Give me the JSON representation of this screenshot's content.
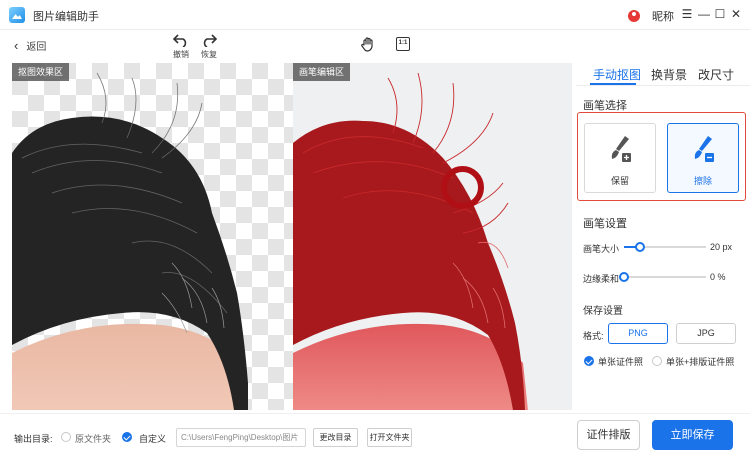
{
  "app": {
    "title": "图片编辑助手",
    "user_name": "昵称"
  },
  "window_controls": {
    "menu": "☰",
    "minimize": "—",
    "maximize": "☐",
    "close": "✕"
  },
  "toolbar": {
    "back": "返回",
    "undo": "撤销",
    "redo": "恢复",
    "hand_icon": "hand-icon",
    "ratio_icon_text": "1:1"
  },
  "panels": {
    "left_label": "抠图效果区",
    "right_label": "画笔编辑区"
  },
  "tabs": [
    {
      "label": "手动抠图",
      "active": true
    },
    {
      "label": "换背景",
      "active": false
    },
    {
      "label": "改尺寸",
      "active": false
    }
  ],
  "brush_select": {
    "title": "画笔选择",
    "options": [
      {
        "label": "保留",
        "icon": "brush-keep-icon",
        "selected": false
      },
      {
        "label": "擦除",
        "icon": "brush-erase-icon",
        "selected": true
      }
    ]
  },
  "brush_settings": {
    "title": "画笔设置",
    "size": {
      "label": "画笔大小",
      "value": "20 px",
      "level": 0.2
    },
    "feather": {
      "label": "边缘柔和",
      "value": "0 %",
      "level": 0.0
    }
  },
  "save_settings": {
    "title": "保存设置",
    "format_label": "格式:",
    "formats": [
      {
        "label": "PNG",
        "selected": true
      },
      {
        "label": "JPG",
        "selected": false
      }
    ],
    "modes": [
      {
        "label": "单张证件照",
        "checked": true
      },
      {
        "label": "单张+排版证件照",
        "checked": false
      }
    ]
  },
  "output": {
    "label": "输出目录:",
    "options": [
      {
        "label": "原文件夹",
        "checked": false
      },
      {
        "label": "自定义",
        "checked": true
      }
    ],
    "path": "C:\\Users\\FengPing\\Desktop\\图片",
    "change_dir": "更改目录",
    "open_folder": "打开文件夹"
  },
  "actions": {
    "layout": "证件排版",
    "save_now": "立即保存"
  },
  "colors": {
    "accent": "#1a73e8",
    "highlight_box": "#e24a3b",
    "brush_red": "#b01015"
  }
}
